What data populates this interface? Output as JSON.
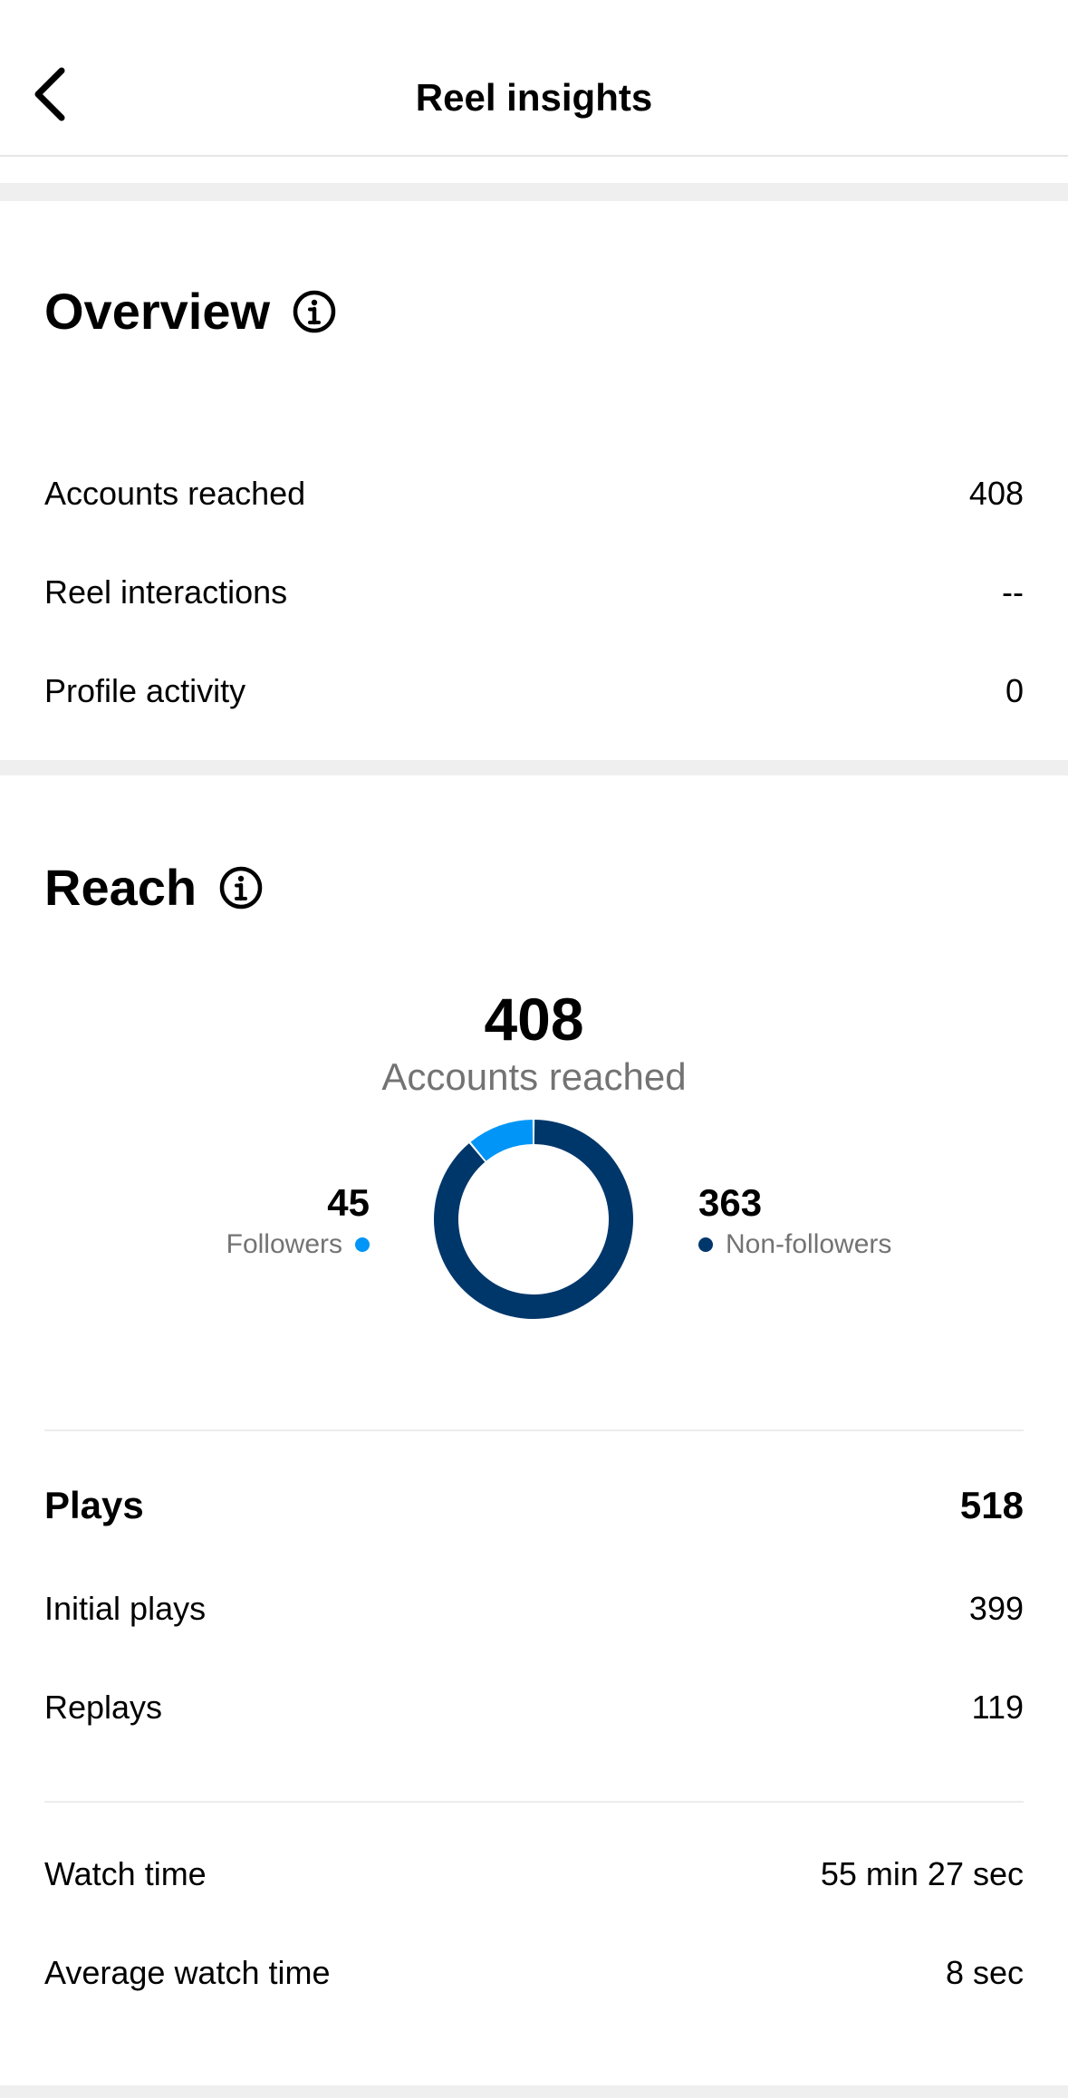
{
  "header": {
    "title": "Reel insights"
  },
  "overview": {
    "title": "Overview",
    "rows": [
      {
        "label": "Accounts reached",
        "value": "408"
      },
      {
        "label": "Reel interactions",
        "value": "--"
      },
      {
        "label": "Profile activity",
        "value": "0"
      }
    ]
  },
  "reach": {
    "title": "Reach",
    "total": "408",
    "total_label": "Accounts reached",
    "followers": {
      "value": "45",
      "label": "Followers",
      "color": "#0095f6"
    },
    "non_followers": {
      "value": "363",
      "label": "Non-followers",
      "color": "#00376b"
    }
  },
  "chart_data": {
    "type": "pie",
    "categories": [
      "Followers",
      "Non-followers"
    ],
    "values": [
      45,
      363
    ],
    "colors": [
      "#0095f6",
      "#00376b"
    ]
  },
  "plays": {
    "label": "Plays",
    "value": "518",
    "initial": {
      "label": "Initial plays",
      "value": "399"
    },
    "replays": {
      "label": "Replays",
      "value": "119"
    }
  },
  "watch": {
    "time": {
      "label": "Watch time",
      "value": "55 min 27 sec"
    },
    "average": {
      "label": "Average watch time",
      "value": "8 sec"
    }
  },
  "icons": {
    "back": "chevron-left-icon",
    "info": "info-icon"
  }
}
